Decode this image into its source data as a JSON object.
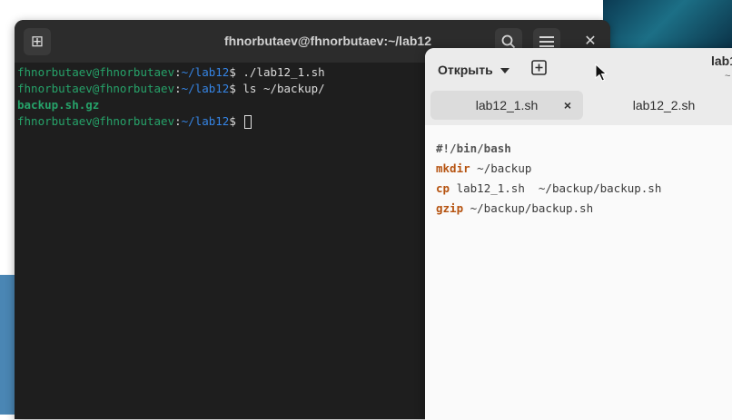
{
  "terminal": {
    "title": "fhnorbutaev@fhnorbutaev:~/lab12",
    "lines": [
      {
        "user": "fhnorbutaev@fhnorbutaev",
        "colon": ":",
        "path": "~/lab12",
        "prompt": "$ ",
        "command": "./lab12_1.sh"
      },
      {
        "user": "fhnorbutaev@fhnorbutaev",
        "colon": ":",
        "path": "~/lab12",
        "prompt": "$ ",
        "command": "ls ~/backup/"
      },
      {
        "output": "backup.sh.gz"
      },
      {
        "user": "fhnorbutaev@fhnorbutaev",
        "colon": ":",
        "path": "~/lab12",
        "prompt": "$ ",
        "command": ""
      }
    ]
  },
  "editor": {
    "open_label": "Открыть",
    "title_partial": "lab1",
    "subtitle_partial": "~",
    "tabs": [
      {
        "label": "lab12_1.sh",
        "close": "×"
      },
      {
        "label": "lab12_2.sh"
      }
    ],
    "code": [
      {
        "kw": "",
        "rest": "#!/bin/bash"
      },
      {
        "kw": "mkdir",
        "rest": " ~/backup"
      },
      {
        "kw": "cp",
        "rest": " lab12_1.sh  ~/backup/backup.sh"
      },
      {
        "kw": "gzip",
        "rest": " ~/backup/backup.sh"
      }
    ]
  },
  "colors": {
    "user": "#26a269",
    "path": "#3584e4",
    "keyword": "#b5520f"
  },
  "icons": [
    "new-tab-icon",
    "search-icon",
    "hamburger-menu-icon",
    "close-icon",
    "new-document-icon",
    "dropdown-arrow-icon",
    "tab-close-icon",
    "mouse-pointer-icon"
  ]
}
